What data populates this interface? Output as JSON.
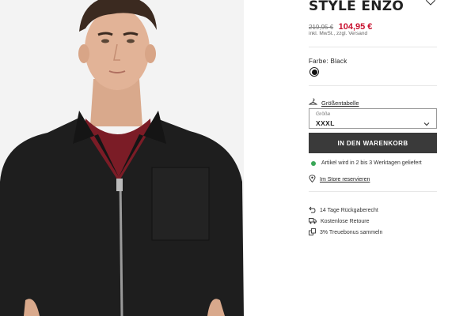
{
  "product": {
    "title": "STYLE ENZO",
    "old_price": "219,95 €",
    "new_price": "104,95 €",
    "tax_note": "inkl. MwSt., zzgl. Versand",
    "color_label": "Farbe:",
    "color_value": "Black",
    "color_swatch": "#111111"
  },
  "size_guide": {
    "label": "Größentabelle"
  },
  "size_select": {
    "label": "Größe",
    "value": "XXXL"
  },
  "cart": {
    "button_label": "IN DEN WARENKORB"
  },
  "delivery": {
    "text": "Artikel wird in 2 bis 3 Werktagen geliefert",
    "status_color": "#3aa757"
  },
  "store": {
    "link_label": "Im Store reservieren"
  },
  "benefits": [
    {
      "icon": "return-arrow-icon",
      "label": "14 Tage Rückgaberecht"
    },
    {
      "icon": "truck-icon",
      "label": "Kostenlose Retoure"
    },
    {
      "icon": "bonus-stack-icon",
      "label": "3% Treuebonus sammeln"
    }
  ],
  "colors": {
    "price_red": "#c8102e",
    "button_dark": "#3a3a3a"
  }
}
